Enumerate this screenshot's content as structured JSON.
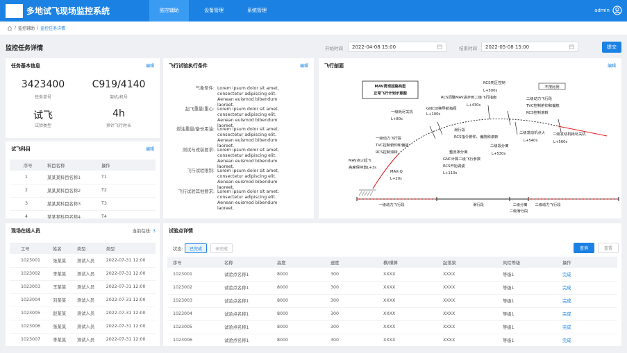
{
  "app": {
    "title": "多地试飞现场监控系统",
    "user": "admin"
  },
  "nav": [
    "监控辅助",
    "设备管理",
    "系统管理"
  ],
  "breadcrumb": {
    "item1": "监控辅助",
    "sep": "/",
    "current": "监控任务详情"
  },
  "page": {
    "title": "监控任务详情",
    "start_label": "开始时间",
    "start_value": "2022-04-08 15:00",
    "end_label": "结束时间",
    "end_value": "2022-05-08 15:00",
    "submit": "提交"
  },
  "basic": {
    "title": "任务基本信息",
    "edit": "编辑",
    "task_no": "3423400",
    "task_no_label": "任务单号",
    "plane": "C919/4140",
    "plane_label": "架机/机号",
    "type": "试飞",
    "type_label": "试验类型",
    "duration": "4h",
    "duration_label": "预计飞行时长"
  },
  "cond": {
    "title": "飞行试验执行条件",
    "edit": "编辑",
    "rows": [
      {
        "label": "气象条件:",
        "value": "Lorem ipsum dolor sit amet, consectetur adipiscing elit. Aenean euismod bibendum laoreet."
      },
      {
        "label": "起飞重量/重心:",
        "value": "Lorem ipsum dolor sit amet, consectetur adipiscing elit. Aenean euismod bibendum laoreet."
      },
      {
        "label": "燃油重量/备份用油:",
        "value": "Lorem ipsum dolor sit amet, consectetur adipiscing elit. Aenean euismod bibendum laoreet."
      },
      {
        "label": "测试与改装要求:",
        "value": "Lorem ipsum dolor sit amet, consectetur adipiscing elit. Aenean euismod bibendum laoreet."
      },
      {
        "label": "飞行试验限制:",
        "value": "Lorem ipsum dolor sit amet, consectetur adipiscing elit. Aenean euismod bibendum laoreet."
      },
      {
        "label": "飞行试验其他要求:",
        "value": "Lorem ipsum dolor sit amet, consectetur adipiscing elit. Aenean euismod bibendum laoreet."
      }
    ]
  },
  "profile": {
    "title": "飞行剖面",
    "edit": "编辑",
    "box_line1": "MAV再现回路构型",
    "box_line2": "正常飞行计划示意图",
    "scale": "不按比例",
    "labels": [
      "RCS死区控制",
      "L+500s",
      "MAV姿态二级飞行指南",
      "RCS调整MAV进步到二级飞行指南",
      "L+430s",
      "GNC切换导航指挥",
      "L+100s",
      "一级耗尽关机",
      "L+80s",
      "滑行段",
      "RCS指令俯仰、偏航和滚转",
      "二级动力飞行段",
      "TVC控制俯仰和偏航",
      "RCS控制滚转",
      "二级发动机点火",
      "L+540s",
      "二级发动机耗尽关机",
      "L+560s",
      "一级动力飞行段",
      "TVC控制俯仰和偏航",
      "RCS控制滚转",
      "整流罩分离",
      "GNC计算二级飞行参数",
      "RCS开始调姿",
      "L+110s",
      "二级段分离",
      "L+530s",
      "MAV点火起飞",
      "高度保持直L+3s",
      "MAX-Q",
      "L+20s"
    ],
    "bottom": [
      "一级动力飞行段",
      "滑行段",
      "二级分离",
      "二级滑行段",
      "二级动力飞行段"
    ]
  },
  "subjects": {
    "title": "试飞科目",
    "edit": "编辑",
    "columns": [
      "序号",
      "科目名称",
      "操作"
    ],
    "rows": [
      [
        "1",
        "某某某科目名称1",
        "T1"
      ],
      [
        "2",
        "某某某科目名称2",
        "T2"
      ],
      [
        "3",
        "某某某科目名称3",
        "T3"
      ],
      [
        "4",
        "某某某科目名称4",
        "T4"
      ]
    ]
  },
  "online": {
    "title": "现场在线人员",
    "count_label": "当前在线:",
    "count": "3",
    "columns": [
      "工号",
      "姓名",
      "类型",
      "类型"
    ],
    "rows": [
      [
        "1023001",
        "张某某",
        "测试人员",
        "2022-07-31 12:00"
      ],
      [
        "1023002",
        "李某某",
        "测试人员",
        "2022-07-31 12:00"
      ],
      [
        "1023003",
        "王某某",
        "测试人员",
        "2022-07-31 12:00"
      ],
      [
        "1023004",
        "刘某某",
        "测试人员",
        "2022-07-31 12:00"
      ],
      [
        "1023005",
        "赵某某",
        "测试人员",
        "2022-07-31 12:00"
      ],
      [
        "1023006",
        "张某某",
        "测试人员",
        "2022-07-31 12:00"
      ],
      [
        "1023007",
        "李某某",
        "测试人员",
        "2022-07-31 12:00"
      ]
    ]
  },
  "points": {
    "title": "试验点详情",
    "status_label": "状态:",
    "done": "已完成",
    "undone": "未完成",
    "query": "查询",
    "reset": "重置",
    "columns": [
      "序号",
      "名称",
      "高度",
      "速度",
      "横/横算",
      "起落架",
      "风险等级",
      "操作"
    ],
    "rows": [
      [
        "1023001",
        "试验点名称1",
        "8000",
        "300",
        "XXXX",
        "XXXX",
        "等级1",
        "完成"
      ],
      [
        "1023002",
        "试验点名称1",
        "8000",
        "300",
        "XXXX",
        "XXXX",
        "等级1",
        "完成"
      ],
      [
        "1023003",
        "试验点名称1",
        "8000",
        "300",
        "XXXX",
        "XXXX",
        "等级1",
        "完成"
      ],
      [
        "1023004",
        "试验点名称1",
        "8000",
        "300",
        "XXXX",
        "XXXX",
        "等级1",
        "完成"
      ],
      [
        "1023005",
        "试验点名称1",
        "8000",
        "300",
        "XXXX",
        "XXXX",
        "等级1",
        "完成"
      ],
      [
        "1023006",
        "试验点名称1",
        "8000",
        "300",
        "XXXX",
        "XXXX",
        "等级1",
        "完成"
      ]
    ]
  },
  "colors": {
    "primary": "#1b82e3",
    "accent_red": "#e02020"
  },
  "icons": [
    "home-icon",
    "calendar-icon",
    "user-circle-icon"
  ]
}
